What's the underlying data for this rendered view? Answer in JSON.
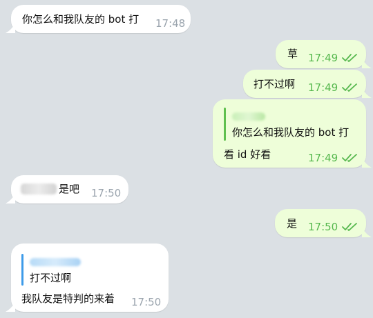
{
  "colors": {
    "background": "#dbe0e4",
    "incoming_bubble": "#ffffff",
    "outgoing_bubble": "#eefed9",
    "incoming_time": "#9ba5ae",
    "outgoing_time": "#56b84e",
    "reply_bar_outgoing": "#5fc04e",
    "reply_bar_incoming": "#3d9be9"
  },
  "messages": [
    {
      "direction": "in",
      "text": "你怎么和我队友的 bot 打",
      "time": "17:48"
    },
    {
      "direction": "out",
      "text": "草",
      "time": "17:49",
      "status_icon": "double-check-icon"
    },
    {
      "direction": "out",
      "text": "打不过啊",
      "time": "17:49",
      "status_icon": "double-check-icon"
    },
    {
      "direction": "out",
      "reply_quote": "你怎么和我队友的 bot 打",
      "text": "看 id 好看",
      "time": "17:49",
      "status_icon": "double-check-icon"
    },
    {
      "direction": "in",
      "text": "是吧",
      "time": "17:50"
    },
    {
      "direction": "out",
      "text": "是",
      "time": "17:50",
      "status_icon": "double-check-icon"
    },
    {
      "direction": "in",
      "reply_quote": "打不过啊",
      "text": "我队友是特判的来着",
      "time": "17:50"
    }
  ]
}
